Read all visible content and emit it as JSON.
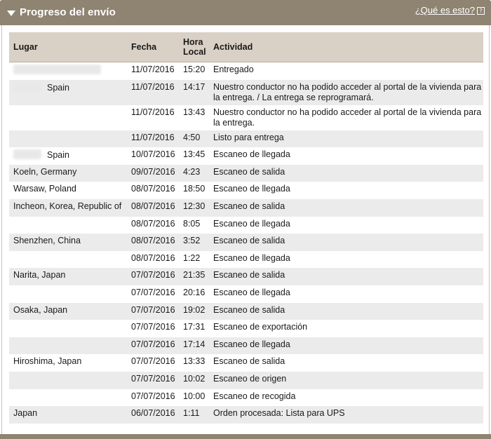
{
  "header": {
    "title": "Progreso del envío",
    "help_label": "¿Qué es esto?",
    "help_icon": "?"
  },
  "table": {
    "columns": [
      "Lugar",
      "Fecha",
      "Hora Local",
      "Actividad"
    ],
    "column_hora_line1": "Hora",
    "column_hora_line2": "Local",
    "rows": [
      {
        "lugar": "",
        "fecha": "11/07/2016",
        "hora": "15:20",
        "actividad": "Entregado"
      },
      {
        "lugar": "Spain",
        "fecha": "11/07/2016",
        "hora": "14:17",
        "actividad": "Nuestro conductor no ha podido acceder al portal de la vivienda para la entrega. / La entrega se reprogramará."
      },
      {
        "lugar": "",
        "fecha": "11/07/2016",
        "hora": "13:43",
        "actividad": "Nuestro conductor no ha podido acceder al portal de la vivienda para la entrega."
      },
      {
        "lugar": "",
        "fecha": "11/07/2016",
        "hora": "4:50",
        "actividad": "Listo para entrega"
      },
      {
        "lugar": "Spain",
        "fecha": "10/07/2016",
        "hora": "13:45",
        "actividad": "Escaneo de llegada"
      },
      {
        "lugar": "Koeln, Germany",
        "fecha": "09/07/2016",
        "hora": "4:23",
        "actividad": "Escaneo de salida"
      },
      {
        "lugar": "Warsaw, Poland",
        "fecha": "08/07/2016",
        "hora": "18:50",
        "actividad": "Escaneo de llegada"
      },
      {
        "lugar": "Incheon, Korea, Republic of",
        "fecha": "08/07/2016",
        "hora": "12:30",
        "actividad": "Escaneo de salida"
      },
      {
        "lugar": "",
        "fecha": "08/07/2016",
        "hora": "8:05",
        "actividad": "Escaneo de llegada"
      },
      {
        "lugar": "Shenzhen, China",
        "fecha": "08/07/2016",
        "hora": "3:52",
        "actividad": "Escaneo de salida"
      },
      {
        "lugar": "",
        "fecha": "08/07/2016",
        "hora": "1:22",
        "actividad": "Escaneo de llegada"
      },
      {
        "lugar": "Narita, Japan",
        "fecha": "07/07/2016",
        "hora": "21:35",
        "actividad": "Escaneo de salida"
      },
      {
        "lugar": "",
        "fecha": "07/07/2016",
        "hora": "20:16",
        "actividad": "Escaneo de llegada"
      },
      {
        "lugar": "Osaka, Japan",
        "fecha": "07/07/2016",
        "hora": "19:02",
        "actividad": "Escaneo de salida"
      },
      {
        "lugar": "",
        "fecha": "07/07/2016",
        "hora": "17:31",
        "actividad": "Escaneo de exportación"
      },
      {
        "lugar": "",
        "fecha": "07/07/2016",
        "hora": "17:14",
        "actividad": "Escaneo de llegada"
      },
      {
        "lugar": "Hiroshima, Japan",
        "fecha": "07/07/2016",
        "hora": "13:33",
        "actividad": "Escaneo de salida"
      },
      {
        "lugar": "",
        "fecha": "07/07/2016",
        "hora": "10:02",
        "actividad": "Escaneo de origen"
      },
      {
        "lugar": "",
        "fecha": "07/07/2016",
        "hora": "10:00",
        "actividad": "Escaneo de recogida"
      },
      {
        "lugar": "Japan",
        "fecha": "06/07/2016",
        "hora": "1:11",
        "actividad": "Orden procesada: Lista para UPS"
      }
    ]
  },
  "colors": {
    "header_bg": "#8f8371",
    "table_header_bg": "#d9d1c5",
    "row_alt_bg": "#ebebeb"
  }
}
